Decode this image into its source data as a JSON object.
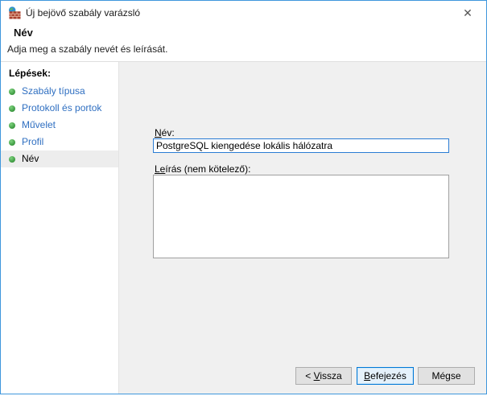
{
  "window": {
    "title": "Új bejövő szabály varázsló",
    "close_glyph": "✕"
  },
  "header": {
    "title": "Név",
    "subtitle": "Adja meg a szabály nevét és leírását."
  },
  "sidebar": {
    "heading": "Lépések:",
    "items": [
      {
        "label": "Szabály típusa",
        "state": "link"
      },
      {
        "label": "Protokoll és portok",
        "state": "link"
      },
      {
        "label": "Művelet",
        "state": "link"
      },
      {
        "label": "Profil",
        "state": "link"
      },
      {
        "label": "Név",
        "state": "current"
      }
    ]
  },
  "form": {
    "name_label": {
      "mnemonic": "N",
      "rest": "év:"
    },
    "name_value": "PostgreSQL kiengedése lokális hálózatra",
    "description_label": {
      "mnemonic": "Le",
      "rest": "írás (nem kötelező):"
    },
    "description_value": ""
  },
  "buttons": {
    "back": {
      "prefix": "< ",
      "mnemonic": "V",
      "rest": "issza"
    },
    "finish": {
      "prefix": "",
      "mnemonic": "B",
      "rest": "efejezés"
    },
    "cancel": {
      "label": "Mégse"
    }
  },
  "colors": {
    "window_border": "#3f97dd",
    "content_bg": "#f0f0f0",
    "link_blue": "#2f6fc1",
    "step_bullet_green": "#43a047",
    "focus_input_border": "#2a7cd4",
    "default_button_border": "#0078d7",
    "default_button_bg": "#e5f1fb",
    "button_bg": "#e1e1e1"
  }
}
